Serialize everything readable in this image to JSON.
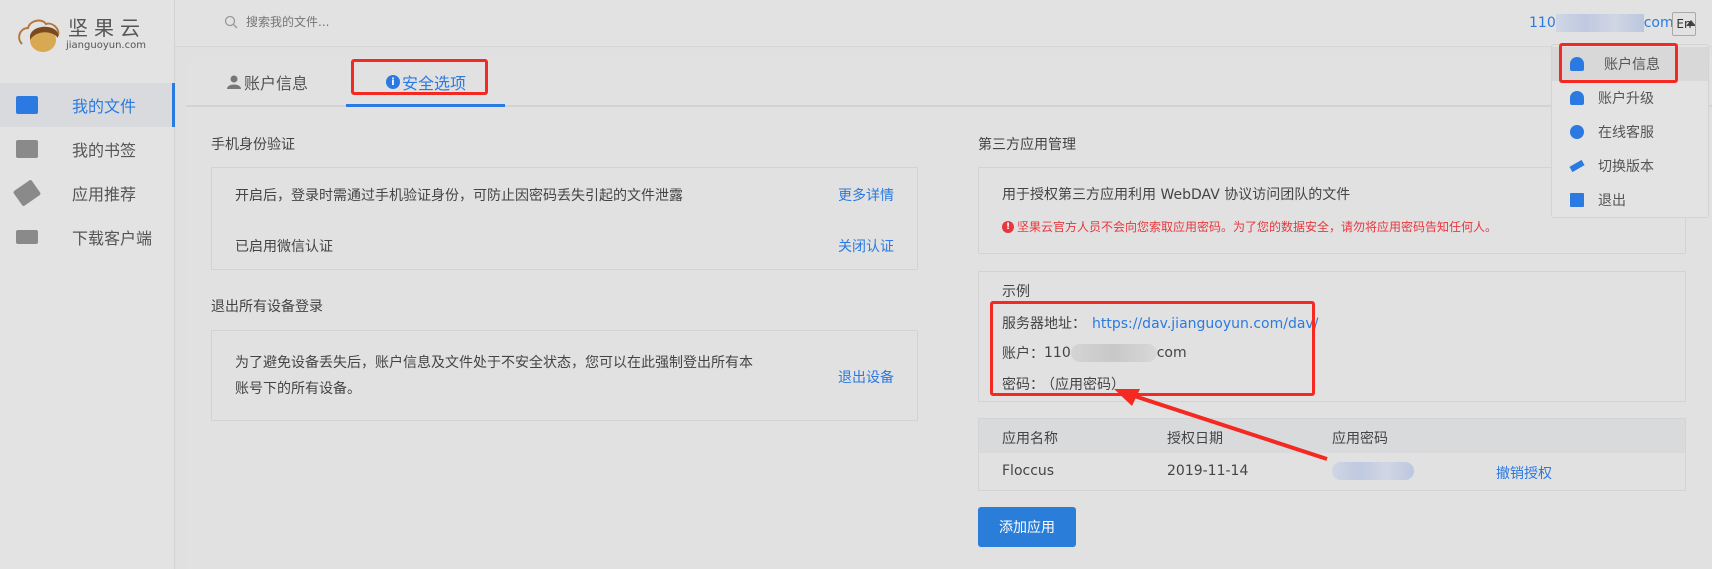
{
  "logo": {
    "name": "坚果云",
    "domain": "jianguoyun.com"
  },
  "search": {
    "placeholder": "搜索我的文件..."
  },
  "user": {
    "email_prefix": "110",
    "email_suffix": "com",
    "lang_button": "En"
  },
  "sidebar": {
    "items": [
      {
        "label": "我的文件",
        "active": true,
        "icon": "folder-icon"
      },
      {
        "label": "我的书签",
        "icon": "bookmark-icon"
      },
      {
        "label": "应用推荐",
        "icon": "tag-icon"
      },
      {
        "label": "下载客户端",
        "icon": "monitor-icon"
      }
    ]
  },
  "tabs": [
    {
      "label": "账户信息",
      "icon": "user-icon"
    },
    {
      "label": "安全选项",
      "icon": "info-icon",
      "active": true
    }
  ],
  "mobile": {
    "title": "手机身份验证",
    "desc": "开启后，登录时需通过手机验证身份，可防止因密码丢失引起的文件泄露",
    "more": "更多详情",
    "status": "已启用微信认证",
    "close": "关闭认证"
  },
  "logout": {
    "title": "退出所有设备登录",
    "line1": "为了避免设备丢失后，账户信息及文件处于不安全状态，您可以在此强制登出所有本",
    "line2": "账号下的所有设备。",
    "action": "退出设备"
  },
  "third": {
    "title": "第三方应用管理",
    "desc": "用于授权第三方应用利用 WebDAV 协议访问团队的文件",
    "warning": "坚果云官方人员不会向您索取应用密码。为了您的数据安全，请勿将应用密码告知任何人。",
    "example": {
      "title": "示例",
      "server_label": "服务器地址：",
      "server_url": "https://dav.jianguoyun.com/dav/",
      "account_label": "账户：",
      "account_prefix": "110",
      "account_suffix": "com",
      "password_label": "密码：",
      "password_value": "（应用密码）"
    },
    "table": {
      "headers": [
        "应用名称",
        "授权日期",
        "应用密码"
      ],
      "rows": [
        {
          "name": "Floccus",
          "date": "2019-11-14",
          "action": "撤销授权"
        }
      ]
    },
    "add_button": "添加应用"
  },
  "menu": {
    "items": [
      "账户信息",
      "账户升级",
      "在线客服",
      "切换版本",
      "退出"
    ]
  },
  "colors": {
    "accent": "#2a7ae2",
    "warning": "#e8373d",
    "highlight": "#f42a22"
  }
}
